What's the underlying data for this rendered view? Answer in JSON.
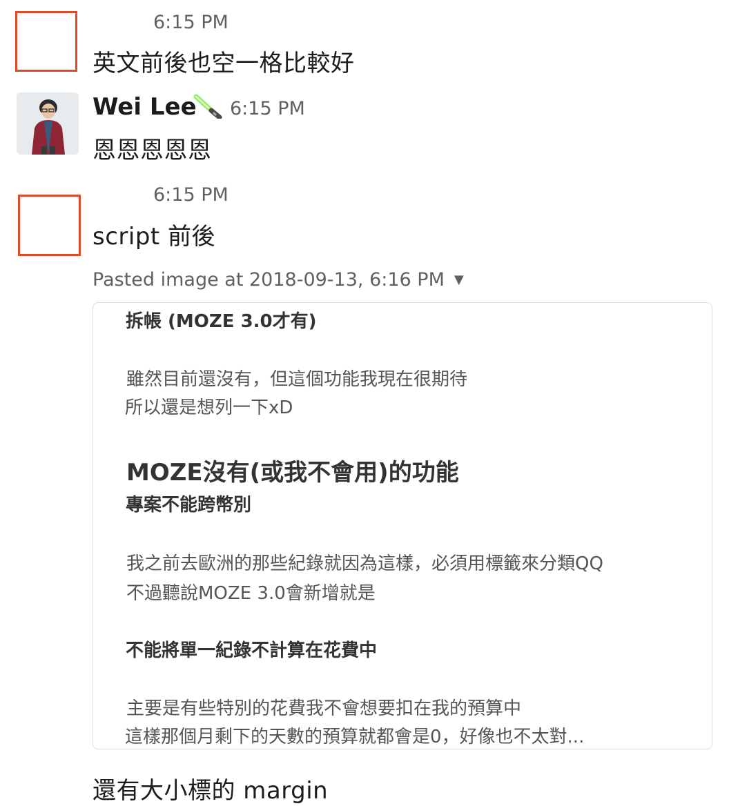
{
  "messages": [
    {
      "time": "6:15 PM",
      "text": "英文前後也空一格比較好"
    },
    {
      "author": "Wei Lee",
      "status_emoji": "lightsaber-emoji",
      "time": "6:15 PM",
      "text": "恩恩恩恩恩"
    },
    {
      "time": "6:15 PM",
      "text": "script 前後",
      "attachment": {
        "title": "Pasted image at 2018-09-13, 6:16 PM",
        "caret_icon": "caret-down-icon",
        "content": {
          "h3_split": "拆帳 (MOZE 3.0才有)",
          "p1_line1": "雖然目前還沒有，但這個功能我現在很期待",
          "p1_line2": " 所以還是想列一下xD",
          "h2_missing": "MOZE沒有(或我不會用)的功能",
          "h3_project": "專案不能跨幣別",
          "p2_line1": "我之前去歐洲的那些紀錄就因為這樣，必須用標籤來分類QQ",
          "p2_line2": "不過聽說MOZE 3.0會新增就是",
          "h3_exclude": "不能將單一紀錄不計算在花費中",
          "p3_line1": "主要是有些特別的花費我不會想要扣在我的預算中",
          "p3_line2": " 這樣那個月剩下的天數的預算就都會是0，好像也不太對..."
        }
      }
    },
    {
      "text": "還有大小標的 margin"
    }
  ],
  "colors": {
    "placeholder_border": "#e04a2c",
    "text": "#1d1c1d",
    "muted": "#616061"
  }
}
